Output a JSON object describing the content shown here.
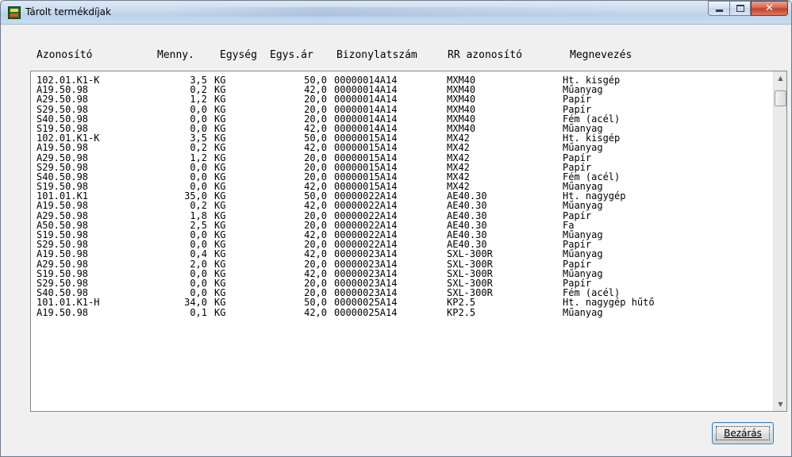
{
  "window": {
    "title": "Tárolt termékdíjak"
  },
  "columns": {
    "id": "Azonosító",
    "qty": "Menny.",
    "unit": "Egység",
    "unit_price": "Egys.ár",
    "doc_no": "Bizonylatszám",
    "rr_id": "RR azonosító",
    "name": "Megnevezés"
  },
  "rows": [
    {
      "id": "102.01.K1-K",
      "qty": "3,5",
      "unit": "KG",
      "price": "50,0",
      "doc": "00000014A14",
      "rr": "MXM40",
      "name": "Ht. kisgép"
    },
    {
      "id": "A19.50.98",
      "qty": "0,2",
      "unit": "KG",
      "price": "42,0",
      "doc": "00000014A14",
      "rr": "MXM40",
      "name": "Műanyag"
    },
    {
      "id": "A29.50.98",
      "qty": "1,2",
      "unit": "KG",
      "price": "20,0",
      "doc": "00000014A14",
      "rr": "MXM40",
      "name": "Papír"
    },
    {
      "id": "S29.50.98",
      "qty": "0,0",
      "unit": "KG",
      "price": "20,0",
      "doc": "00000014A14",
      "rr": "MXM40",
      "name": "Papír"
    },
    {
      "id": "S40.50.98",
      "qty": "0,0",
      "unit": "KG",
      "price": "20,0",
      "doc": "00000014A14",
      "rr": "MXM40",
      "name": "Fém (acél)"
    },
    {
      "id": "S19.50.98",
      "qty": "0,0",
      "unit": "KG",
      "price": "42,0",
      "doc": "00000014A14",
      "rr": "MXM40",
      "name": "Műanyag"
    },
    {
      "id": "102.01.K1-K",
      "qty": "3,5",
      "unit": "KG",
      "price": "50,0",
      "doc": "00000015A14",
      "rr": "MX42",
      "name": "Ht. kisgép"
    },
    {
      "id": "A19.50.98",
      "qty": "0,2",
      "unit": "KG",
      "price": "42,0",
      "doc": "00000015A14",
      "rr": "MX42",
      "name": "Műanyag"
    },
    {
      "id": "A29.50.98",
      "qty": "1,2",
      "unit": "KG",
      "price": "20,0",
      "doc": "00000015A14",
      "rr": "MX42",
      "name": "Papír"
    },
    {
      "id": "S29.50.98",
      "qty": "0,0",
      "unit": "KG",
      "price": "20,0",
      "doc": "00000015A14",
      "rr": "MX42",
      "name": "Papír"
    },
    {
      "id": "S40.50.98",
      "qty": "0,0",
      "unit": "KG",
      "price": "20,0",
      "doc": "00000015A14",
      "rr": "MX42",
      "name": "Fém (acél)"
    },
    {
      "id": "S19.50.98",
      "qty": "0,0",
      "unit": "KG",
      "price": "42,0",
      "doc": "00000015A14",
      "rr": "MX42",
      "name": "Műanyag"
    },
    {
      "id": "101.01.K1",
      "qty": "35,0",
      "unit": "KG",
      "price": "50,0",
      "doc": "00000022A14",
      "rr": "AE40.30",
      "name": "Ht. nagygép"
    },
    {
      "id": "A19.50.98",
      "qty": "0,2",
      "unit": "KG",
      "price": "42,0",
      "doc": "00000022A14",
      "rr": "AE40.30",
      "name": "Műanyag"
    },
    {
      "id": "A29.50.98",
      "qty": "1,8",
      "unit": "KG",
      "price": "20,0",
      "doc": "00000022A14",
      "rr": "AE40.30",
      "name": "Papír"
    },
    {
      "id": "A50.50.98",
      "qty": "2,5",
      "unit": "KG",
      "price": "20,0",
      "doc": "00000022A14",
      "rr": "AE40.30",
      "name": "Fa"
    },
    {
      "id": "S19.50.98",
      "qty": "0,0",
      "unit": "KG",
      "price": "42,0",
      "doc": "00000022A14",
      "rr": "AE40.30",
      "name": "Műanyag"
    },
    {
      "id": "S29.50.98",
      "qty": "0,0",
      "unit": "KG",
      "price": "20,0",
      "doc": "00000022A14",
      "rr": "AE40.30",
      "name": "Papír"
    },
    {
      "id": "A19.50.98",
      "qty": "0,4",
      "unit": "KG",
      "price": "42,0",
      "doc": "00000023A14",
      "rr": "SXL-300R",
      "name": "Műanyag"
    },
    {
      "id": "A29.50.98",
      "qty": "2,0",
      "unit": "KG",
      "price": "20,0",
      "doc": "00000023A14",
      "rr": "SXL-300R",
      "name": "Papír"
    },
    {
      "id": "S19.50.98",
      "qty": "0,0",
      "unit": "KG",
      "price": "42,0",
      "doc": "00000023A14",
      "rr": "SXL-300R",
      "name": "Műanyag"
    },
    {
      "id": "S29.50.98",
      "qty": "0,0",
      "unit": "KG",
      "price": "20,0",
      "doc": "00000023A14",
      "rr": "SXL-300R",
      "name": "Papír"
    },
    {
      "id": "S40.50.98",
      "qty": "0,0",
      "unit": "KG",
      "price": "20,0",
      "doc": "00000023A14",
      "rr": "SXL-300R",
      "name": "Fém (acél)"
    },
    {
      "id": "101.01.K1-H",
      "qty": "34,0",
      "unit": "KG",
      "price": "50,0",
      "doc": "00000025A14",
      "rr": "KP2.5",
      "name": "Ht. nagygép hűtő"
    },
    {
      "id": "A19.50.98",
      "qty": "0,1",
      "unit": "KG",
      "price": "42,0",
      "doc": "00000025A14",
      "rr": "KP2.5",
      "name": "Műanyag"
    }
  ],
  "buttons": {
    "close": "Bezárás"
  },
  "colors": {
    "titlebar": "#c9daee",
    "close_caption": "#c2402a",
    "list_background": "#ffffff",
    "button_border": "#3c7fb1"
  }
}
